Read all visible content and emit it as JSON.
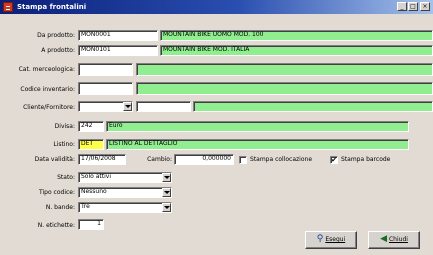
{
  "window": {
    "title": "Stampa frontalini",
    "app_icon": "document-icon",
    "controls": {
      "minimize": "_",
      "maximize": "□",
      "close": "×"
    }
  },
  "form": {
    "da_prodotto": {
      "label": "Da prodotto:",
      "code": "MON0001",
      "description": "MOUNTAIN BIKE UOMO MOD. 100"
    },
    "a_prodotto": {
      "label": "A prodotto:",
      "code": "MON0101",
      "description": "MOUNTAIN BIKE MOD. ITALIA"
    },
    "cat_merceologica": {
      "label": "Cat. merceologica:",
      "code": "",
      "description": ""
    },
    "codice_inventario": {
      "label": "Codice inventario:",
      "code": "",
      "description": ""
    },
    "cliente_fornitore": {
      "label": "Cliente/Fornitore:",
      "type": "",
      "code": "",
      "description": ""
    },
    "divisa": {
      "label": "Divisa:",
      "code": "242",
      "description": "Euro"
    },
    "listino": {
      "label": "Listino:",
      "code": "DET",
      "description": "LISTINO AL DETTAGLIO"
    },
    "data_validita": {
      "label": "Data validità:",
      "value": "17/06/2008"
    },
    "cambio": {
      "label": "Cambio:",
      "value": "0,000000"
    },
    "stampa_collocazione": {
      "label": "Stampa collocazione",
      "checked": false
    },
    "stampa_barcode": {
      "label": "Stampa barcode",
      "checked": true,
      "mark": "✔"
    },
    "stato": {
      "label": "Stato:",
      "value": "Solo attivi"
    },
    "tipo_codice": {
      "label": "Tipo codice:",
      "value": "Nessuno"
    },
    "n_bande": {
      "label": "N. bande:",
      "value": "Tre"
    },
    "n_etichette": {
      "label": "N. etichette:",
      "value": "1"
    }
  },
  "buttons": {
    "esegui": {
      "label": "Esegui",
      "icon": "run-icon",
      "glyph": "⚲"
    },
    "chiudi": {
      "label": "Chiudi",
      "icon": "close-door-icon",
      "glyph": "◀"
    }
  },
  "colors": {
    "description_field": "#90ee90",
    "listino_code_field": "#ffff4a",
    "window_background": "#e1dbd3",
    "titlebar_start": "#0a1f7a",
    "titlebar_end": "#a6c1ea"
  }
}
